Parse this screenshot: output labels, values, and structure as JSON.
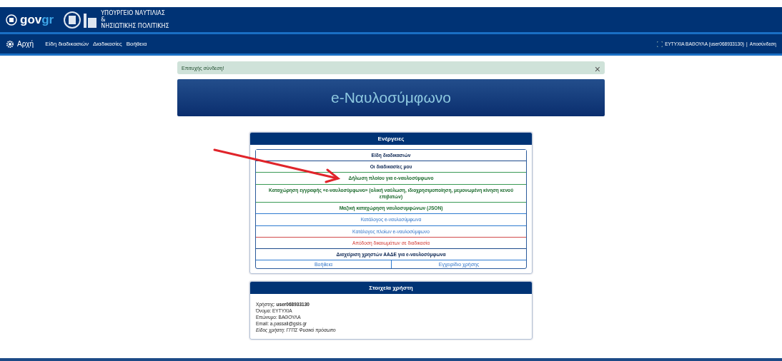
{
  "header": {
    "logo": {
      "main": "gov",
      "accent": "gr"
    },
    "ministry": [
      "ΥΠΟΥΡΓΕΙΟ ΝΑΥΤΙΛΙΑΣ",
      "&",
      "ΝΗΣΙΩΤΙΚΗΣ ΠΟΛΙΤΙΚΗΣ"
    ]
  },
  "nav": {
    "home": "Αρχή",
    "items": [
      "Είδη διαδικασιών",
      "Διαδικασίες",
      "Βοήθεια"
    ],
    "user": "ΕΥΤΥΧΙΑ ΒΑΘΟΥΛΑ (user068933130)",
    "separator": "|",
    "logout": "Αποσύνδεση"
  },
  "alert": {
    "message": "Επιτυχής σύνδεση!",
    "close": "×"
  },
  "banner": {
    "title": "e-Ναυλοσύμφωνο"
  },
  "actions": {
    "title": "Ενέργειες",
    "items": [
      {
        "label": "Είδη διαδικασιών",
        "kind": "primary"
      },
      {
        "label": "Οι διαδικασίες μου",
        "kind": "primary"
      },
      {
        "label": "Δήλωση πλοίου για e-ναυλοσύμφωνο",
        "kind": "success"
      },
      {
        "label": "Καταχώρηση εγγραφής «e-ναυλοσύμφωνο» (ολική ναύλωση, ιδιοχρησιμοποίηση, μεμονωμένη κίνηση κενού επιβατών)",
        "kind": "success"
      },
      {
        "label": "Μαζική καταχώρηση ναυλοσυμφώνων (JSON)",
        "kind": "success"
      },
      {
        "label": "Κατάλογος e-ναυλοσύμφωνα",
        "kind": "info"
      },
      {
        "label": "Κατάλογος πλοίων e-ναυλοσύμφωνο",
        "kind": "info"
      },
      {
        "label": "Απόδοση δικαιωμάτων σε διαδικασία",
        "kind": "danger"
      },
      {
        "label": "Διαχείριση χρηστών ΑΑΔΕ για e-ναυλοσύμφωνα",
        "kind": "primary"
      }
    ],
    "footer_links": [
      "Βοήθεια",
      "Εγχειρίδιο χρήσης"
    ]
  },
  "user_panel": {
    "title": "Στοιχεία χρήστη",
    "lines": [
      {
        "text": "Χρήστης: **user068933130**",
        "italic": false
      },
      {
        "text": "Όνομα: ΕΥΤΥΧΙΑ",
        "italic": false
      },
      {
        "text": "Επώνυμο: ΒΑΘΟΥΛΑ",
        "italic": false
      },
      {
        "text": "Email: a.passali@gsis.gr",
        "italic": false
      },
      {
        "text": "Είδος χρήστη: ΓΓΠΣ Φυσικό πρόσωπο",
        "italic": true
      }
    ]
  }
}
